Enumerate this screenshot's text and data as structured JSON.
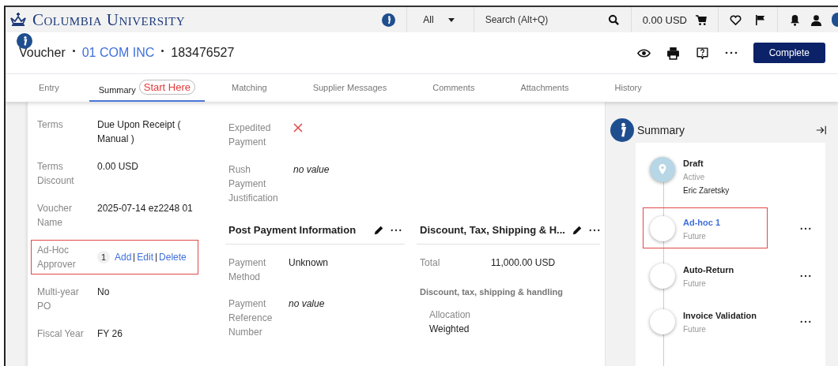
{
  "header": {
    "logo": "Columbia University",
    "scope": "All",
    "search": {
      "placeholder": "Search (Alt+Q)"
    },
    "cart_total": "0.00 USD"
  },
  "title": {
    "doc_type": "Voucher",
    "supplier": "01 COM INC",
    "number": "183476527"
  },
  "actions": {
    "primary": "Complete"
  },
  "tabs": [
    {
      "label": "Entry",
      "selected": false
    },
    {
      "label": "Summary",
      "selected": true,
      "badge": "Start Here"
    },
    {
      "label": "Matching",
      "selected": false
    },
    {
      "label": "Supplier Messages",
      "selected": false
    },
    {
      "label": "Comments",
      "selected": false
    },
    {
      "label": "Attachments",
      "selected": false
    },
    {
      "label": "History",
      "selected": false
    }
  ],
  "general_fields": [
    {
      "label": "Terms",
      "kind": "text",
      "value": "Due Upon Receipt ( Manual )"
    },
    {
      "label": "Terms Discount",
      "kind": "text",
      "value": "0.00 USD"
    },
    {
      "label": "Voucher Name",
      "kind": "text",
      "value": "2025-07-14 ez2248 01"
    },
    {
      "label": "Ad-Hoc Approver",
      "kind": "approver",
      "count": "1",
      "links": [
        "Add",
        "Edit",
        "Delete"
      ],
      "highlighted": true
    },
    {
      "label": "Multi-year PO",
      "kind": "text",
      "value": "No"
    },
    {
      "label": "Fiscal Year",
      "kind": "text",
      "value": "FY 26"
    }
  ],
  "payment_fields": [
    {
      "label": "Expedited Payment",
      "kind": "flag",
      "checked": false
    },
    {
      "label": "Rush Payment Justification",
      "kind": "empty",
      "value": "no value"
    }
  ],
  "post_payment": {
    "title": "Post Payment Information",
    "fields": [
      {
        "label": "Payment Method",
        "kind": "text",
        "value": "Unknown"
      },
      {
        "label": "Payment Reference Number",
        "kind": "empty",
        "value": "no value"
      }
    ]
  },
  "discount": {
    "title": "Discount, Tax, Shipping & H...",
    "fields": [
      {
        "label": "Total",
        "value": "11,000.00 USD"
      }
    ],
    "subheading": "Discount, tax, shipping & handling",
    "allocation": {
      "label": "Allocation",
      "value": "Weighted"
    }
  },
  "summary": {
    "title": "Summary",
    "steps": [
      {
        "name": "Draft",
        "status": "Active",
        "person": "Eric Zaretsky",
        "current": true,
        "link": false,
        "highlighted": false
      },
      {
        "name": "Ad-hoc 1",
        "status": "Future",
        "current": false,
        "link": true,
        "highlighted": true
      },
      {
        "name": "Auto-Return",
        "status": "Future",
        "current": false,
        "link": false,
        "highlighted": false
      },
      {
        "name": "Invoice Validation",
        "status": "Future",
        "current": false,
        "link": false,
        "highlighted": false
      }
    ]
  }
}
